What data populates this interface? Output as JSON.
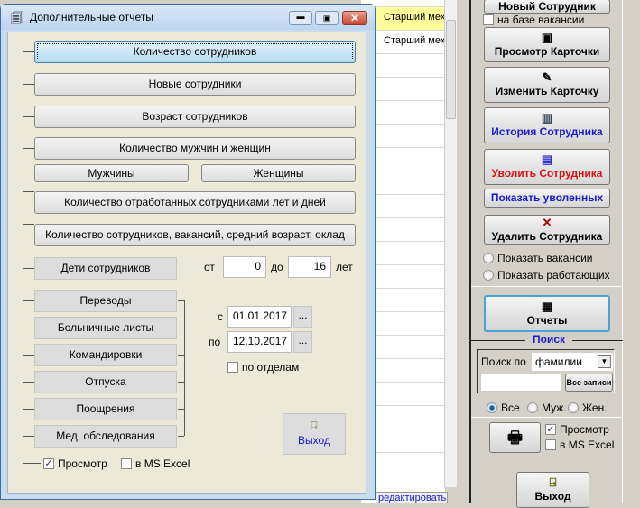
{
  "background": {
    "grid_rows": [
      "Старший мех",
      "Старший мех"
    ],
    "bottom_partial_link": "редактировать",
    "right_panel": {
      "new_employee_button": "Новый Сотрудник",
      "vacancy_checkbox": "на базе вакансии",
      "view_card": "Просмотр Карточки",
      "edit_card": "Изменить Карточку",
      "history": "История Сотрудника",
      "dismiss": "Уволить Сотрудника",
      "show_dismissed": "Показать уволенных",
      "delete": "Удалить Сотрудника",
      "show_vacancies": "Показать вакансии",
      "show_working": "Показать работающих",
      "reports": "Отчеты",
      "search_legend": "Поиск",
      "search_by_label": "Поиск по",
      "search_by_value": "фамилии",
      "search_input_value": "",
      "all_records": "Все записи",
      "gender_all": "Все",
      "gender_male": "Муж.",
      "gender_female": "Жен.",
      "preview": "Просмотр",
      "excel": "в MS Excel",
      "exit": "Выход"
    }
  },
  "dialog": {
    "title": "Дополнительные отчеты",
    "buttons": {
      "count": "Количество сотрудников",
      "new": "Новые сотрудники",
      "age": "Возраст сотрудников",
      "gender": "Количество мужчин и женщин",
      "men": "Мужчины",
      "women": "Женщины",
      "years_worked": "Количество отработанных сотрудниками лет и дней",
      "summary": "Количество сотрудников, вакансий, средний возраст, оклад",
      "children": "Дети сотрудников",
      "transfers": "Переводы",
      "sick": "Больничные листы",
      "trips": "Командировки",
      "vacations": "Отпуска",
      "rewards": "Поощрения",
      "medical": "Мед. обследования",
      "exit": "Выход",
      "date_picker": "..."
    },
    "age_from_label": "от",
    "age_from": "0",
    "age_to_label": "до",
    "age_to": "16",
    "age_unit": "лет",
    "date_from_label": "с",
    "date_from": "01.01.2017",
    "date_to_label": "по",
    "date_to": "12.10.2017",
    "by_department": "по отделам",
    "preview": "Просмотр",
    "preview_checked": true,
    "excel": "в MS Excel",
    "excel_checked": false
  },
  "colors": {
    "blue_text": "#1a1ad0",
    "red_text": "#e01010",
    "selected_row": "#ffff99"
  }
}
